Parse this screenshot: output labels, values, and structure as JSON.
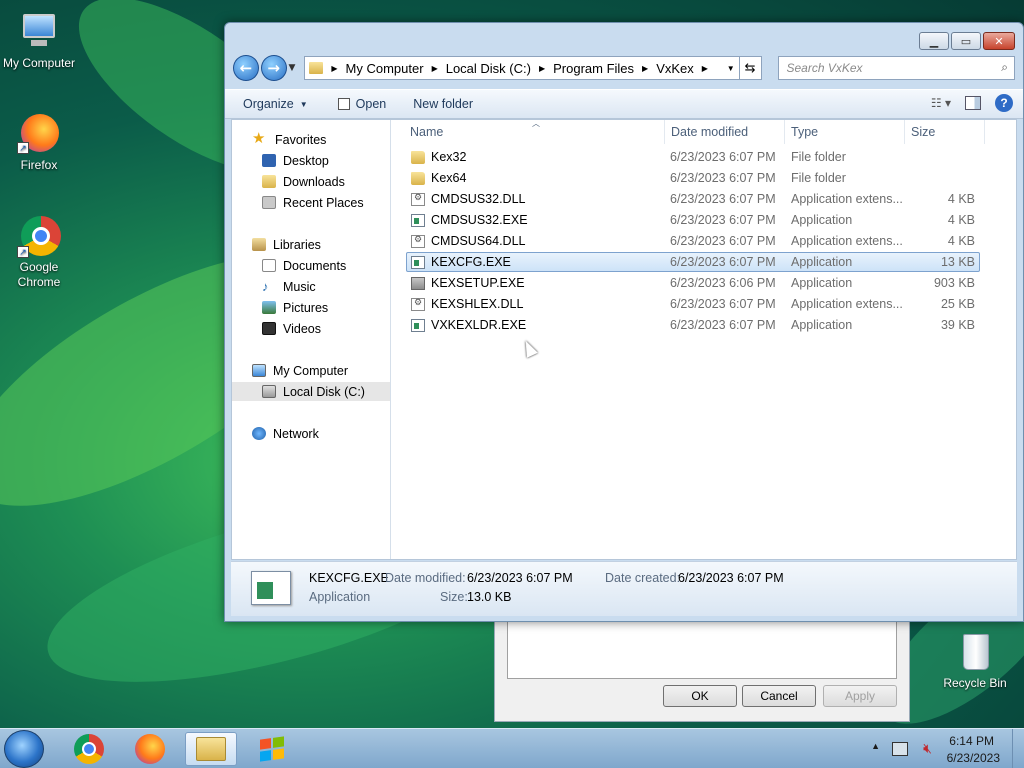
{
  "desktop": {
    "icons": [
      {
        "label": "My Computer"
      },
      {
        "label": "Firefox"
      },
      {
        "label": "Google Chrome"
      },
      {
        "label": "Recycle Bin"
      }
    ]
  },
  "explorer": {
    "address": {
      "crumbs": [
        "My Computer",
        "Local Disk (C:)",
        "Program Files",
        "VxKex"
      ]
    },
    "search_placeholder": "Search VxKex",
    "toolbar": {
      "organize": "Organize",
      "open": "Open",
      "new_folder": "New folder"
    },
    "nav": {
      "favorites": "Favorites",
      "desktop": "Desktop",
      "downloads": "Downloads",
      "recent_places": "Recent Places",
      "libraries": "Libraries",
      "documents": "Documents",
      "music": "Music",
      "pictures": "Pictures",
      "videos": "Videos",
      "my_computer": "My Computer",
      "local_disk": "Local Disk (C:)",
      "network": "Network"
    },
    "columns": {
      "name": "Name",
      "date": "Date modified",
      "type": "Type",
      "size": "Size"
    },
    "files": [
      {
        "name": "Kex32",
        "date": "6/23/2023 6:07 PM",
        "type": "File folder",
        "size": "",
        "icon": "folder-icon"
      },
      {
        "name": "Kex64",
        "date": "6/23/2023 6:07 PM",
        "type": "File folder",
        "size": "",
        "icon": "folder-icon"
      },
      {
        "name": "CMDSUS32.DLL",
        "date": "6/23/2023 6:07 PM",
        "type": "Application extens...",
        "size": "4 KB",
        "icon": "dll-icon"
      },
      {
        "name": "CMDSUS32.EXE",
        "date": "6/23/2023 6:07 PM",
        "type": "Application",
        "size": "4 KB",
        "icon": "application-icon"
      },
      {
        "name": "CMDSUS64.DLL",
        "date": "6/23/2023 6:07 PM",
        "type": "Application extens...",
        "size": "4 KB",
        "icon": "dll-icon"
      },
      {
        "name": "KEXCFG.EXE",
        "date": "6/23/2023 6:07 PM",
        "type": "Application",
        "size": "13 KB",
        "icon": "application-icon",
        "selected": true
      },
      {
        "name": "KEXSETUP.EXE",
        "date": "6/23/2023 6:06 PM",
        "type": "Application",
        "size": "903 KB",
        "icon": "setup-icon"
      },
      {
        "name": "KEXSHLEX.DLL",
        "date": "6/23/2023 6:07 PM",
        "type": "Application extens...",
        "size": "25 KB",
        "icon": "dll-icon"
      },
      {
        "name": "VXKEXLDR.EXE",
        "date": "6/23/2023 6:07 PM",
        "type": "Application",
        "size": "39 KB",
        "icon": "application-icon"
      }
    ],
    "details": {
      "name": "KEXCFG.EXE",
      "type": "Application",
      "date_modified_label": "Date modified:",
      "date_modified": "6/23/2023 6:07 PM",
      "date_created_label": "Date created:",
      "date_created": "6/23/2023 6:07 PM",
      "size_label": "Size:",
      "size": "13.0 KB"
    }
  },
  "dialog": {
    "ok": "OK",
    "cancel": "Cancel",
    "apply": "Apply"
  },
  "taskbar": {
    "time": "6:14 PM",
    "date": "6/23/2023"
  },
  "colors": {
    "selection": "#cde3f8",
    "window_frame": "#c9dcef",
    "taskbar": "#7fa7cc"
  }
}
